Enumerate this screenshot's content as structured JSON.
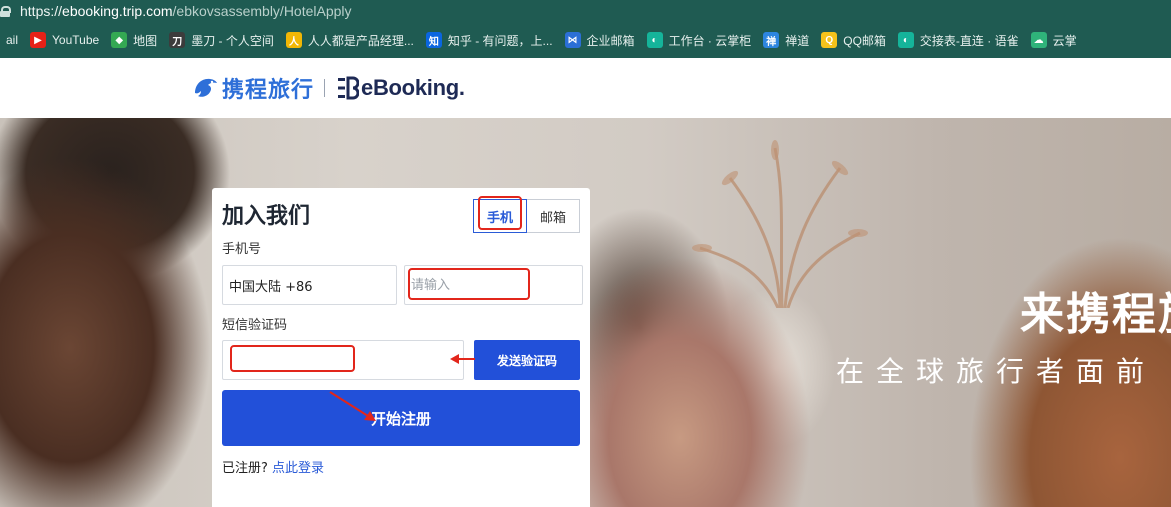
{
  "browser": {
    "url_scheme": "https://",
    "url_host": "ebooking.trip.com",
    "url_path": "/ebkovsassembly/HotelApply",
    "bookmarks": [
      {
        "label": "ail",
        "icon": "gmail-icon",
        "color": "#1f5b52"
      },
      {
        "label": "YouTube",
        "icon": "youtube-icon",
        "color": "#e62117"
      },
      {
        "label": "地图",
        "icon": "maps-icon",
        "color": "#34a853"
      },
      {
        "label": "墨刀 - 个人空间",
        "icon": "modao-icon",
        "color": "#3c3c3c"
      },
      {
        "label": "人人都是产品经理...",
        "icon": "woshipm-icon",
        "color": "#f2b705"
      },
      {
        "label": "知乎 - 有问题，上...",
        "icon": "zhihu-icon",
        "color": "#0a66e0"
      },
      {
        "label": "企业邮箱",
        "icon": "qiye-mail-icon",
        "color": "#2b6fd6"
      },
      {
        "label": "工作台 · 云掌柜",
        "icon": "yunzhanggui-icon",
        "color": "#15b49a"
      },
      {
        "label": "禅道",
        "icon": "chandao-icon",
        "color": "#2d86e0"
      },
      {
        "label": "QQ邮箱",
        "icon": "qq-mail-icon",
        "color": "#f4c21b"
      },
      {
        "label": "交接表-直连 · 语雀",
        "icon": "yuque-icon",
        "color": "#15b49a"
      },
      {
        "label": "云掌",
        "icon": "cloud-icon",
        "color": "#2fb37a"
      }
    ]
  },
  "header": {
    "ctrip_name": "携程旅行",
    "ebooking_name": "eBooking."
  },
  "hero": {
    "title": "来携程旅",
    "subtitle": "在全球旅行者面前"
  },
  "form": {
    "title": "加入我们",
    "tabs": [
      {
        "label": "手机",
        "active": true
      },
      {
        "label": "邮箱",
        "active": false
      }
    ],
    "phone_label": "手机号",
    "country_value": "中国大陆 +86",
    "phone_placeholder": "请输入",
    "code_label": "短信验证码",
    "send_code_label": "发送验证码",
    "register_label": "开始注册",
    "login_prompt": "已注册?",
    "login_link": "点此登录"
  },
  "colors": {
    "primary": "#2250d9",
    "browser_bar": "#1f5b52",
    "annotation": "#e2261b"
  }
}
